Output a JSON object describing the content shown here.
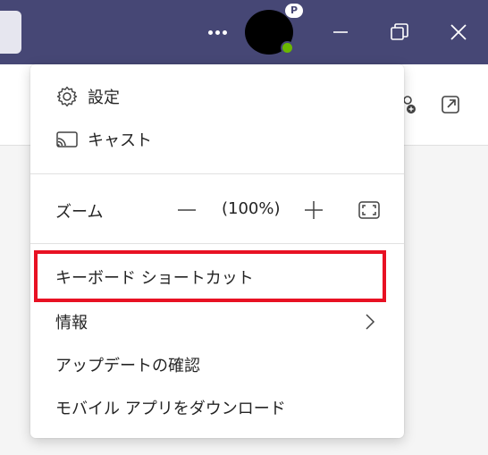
{
  "titlebar": {
    "presence_badge": "P",
    "accent": "#464775",
    "presence_color": "#6bb700"
  },
  "menu": {
    "settings_label": "設定",
    "cast_label": "キャスト",
    "zoom": {
      "label": "ズーム",
      "value": "(100%)"
    },
    "keyboard_shortcuts_label": "キーボード ショートカット",
    "about_label": "情報",
    "check_updates_label": "アップデートの確認",
    "download_mobile_label": "モバイル アプリをダウンロード",
    "highlight_color": "#e81123"
  }
}
